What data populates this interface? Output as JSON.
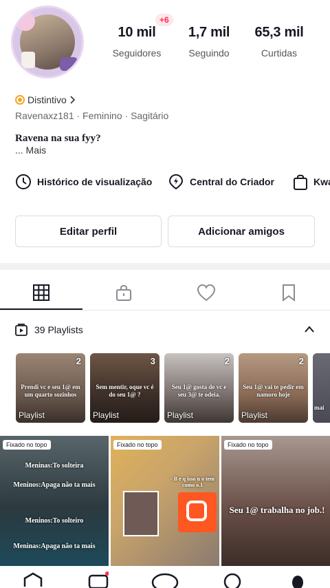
{
  "header": {
    "new_badge": "+6",
    "stats": [
      {
        "value": "10 mil",
        "label": "Seguidores"
      },
      {
        "value": "1,7 mil",
        "label": "Seguindo"
      },
      {
        "value": "65,3 mil",
        "label": "Curtidas"
      }
    ]
  },
  "profile": {
    "badge_label": "Distintivo",
    "meta": "Ravenaxz181 · Feminino · Sagitário",
    "bio": "Ravena na sua fyy?",
    "more": "... Mais"
  },
  "shortcuts": [
    {
      "label": "Histórico de visualização",
      "icon": "clock-icon"
    },
    {
      "label": "Central do Criador",
      "icon": "lightning-pin-icon"
    },
    {
      "label": "Kwa",
      "icon": "shopping-bag-icon"
    }
  ],
  "buttons": {
    "edit": "Editar perfil",
    "add_friends": "Adicionar amigos"
  },
  "tabs": [
    {
      "name": "grid",
      "icon": "grid-icon",
      "active": true
    },
    {
      "name": "private",
      "icon": "lock-icon",
      "active": false
    },
    {
      "name": "liked",
      "icon": "heart-icon",
      "active": false
    },
    {
      "name": "saved",
      "icon": "bookmark-icon",
      "active": false
    }
  ],
  "playlists": {
    "header": "39 Playlists",
    "items": [
      {
        "count": "2",
        "label": "Playlist",
        "caption": "Prendi vc e seu 1@ em um quarto sozinhos",
        "color": "#6b5a4e"
      },
      {
        "count": "3",
        "label": "Playlist",
        "caption": "Sem mentir, oque vc é do seu 1@ ?",
        "color": "#3d2f28"
      },
      {
        "count": "2",
        "label": "Playlist",
        "caption": "Seu 1@ gosta de vc e seu 3@ te odeia.",
        "color": "#7a6f6c"
      },
      {
        "count": "2",
        "label": "Playlist",
        "caption": "Seu 1@ vai te pedir em namoro hoje",
        "color": "#8a6a55"
      },
      {
        "count": "",
        "label": "",
        "caption": "mai",
        "color": "#4a4a55"
      }
    ]
  },
  "videos": [
    {
      "pinned": "Fixado no topo",
      "texts": [
        "Meninas:To solteira",
        "Meninos:Apaga não ta mais",
        "Meninos:To solteiro",
        "Meninas:Apaga não ta mais"
      ],
      "color": "#2c3a3f"
    },
    {
      "pinned": "Fixado no topo",
      "texts": [
        "- B e q isso n o tem como o.1"
      ],
      "color": "#c9a46a"
    },
    {
      "pinned": "Fixado no topo",
      "texts": [
        "Seu 1@ trabalha no job.!"
      ],
      "color": "#6a5048"
    }
  ],
  "nav_icons": [
    "home-icon",
    "friends-icon",
    "create-icon",
    "inbox-icon",
    "profile-icon"
  ]
}
